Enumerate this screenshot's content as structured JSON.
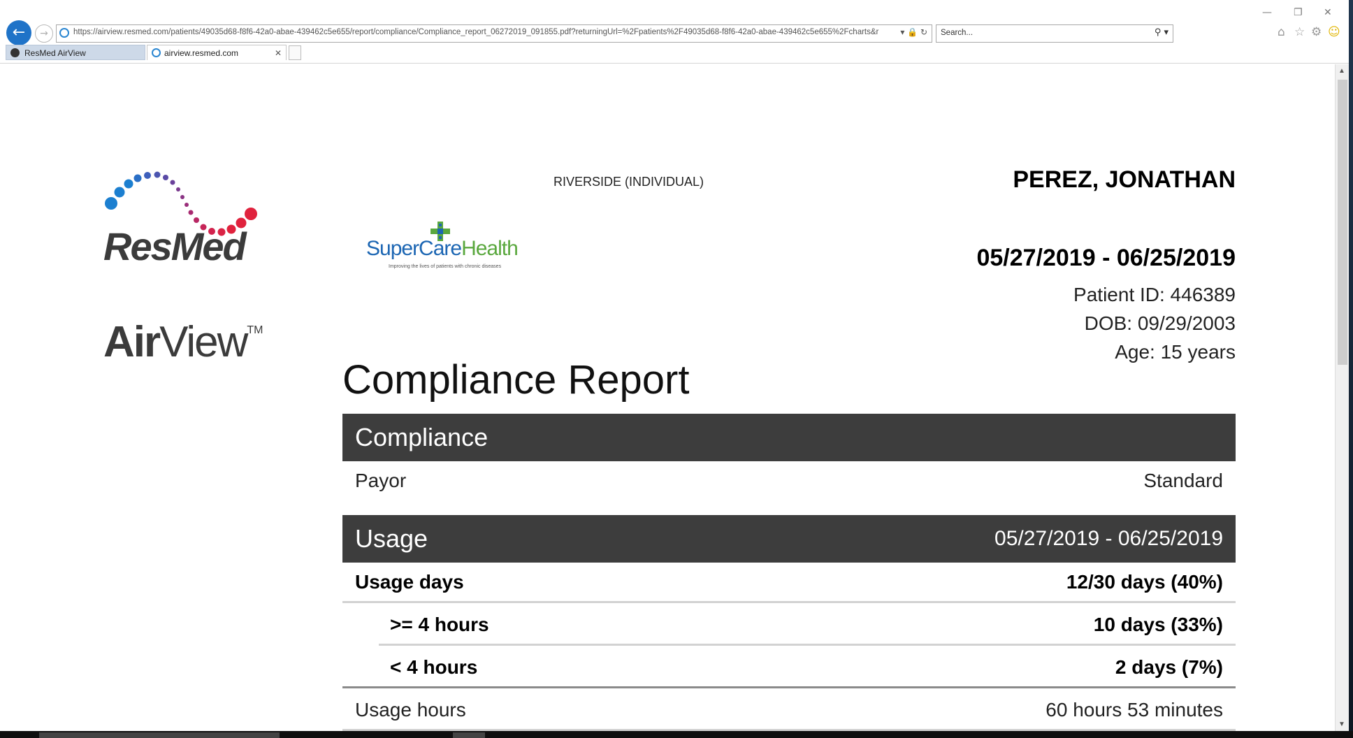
{
  "browser": {
    "url": "https://airview.resmed.com/patients/49035d68-f8f6-42a0-abae-439462c5e655/report/compliance/Compliance_report_06272019_091855.pdf?returningUrl=%2Fpatients%2F49035d68-f8f6-42a0-abae-439462c5e655%2Fcharts&r",
    "search_placeholder": "Search...",
    "tabs": [
      {
        "label": "ResMed AirView"
      },
      {
        "label": "airview.resmed.com"
      }
    ]
  },
  "brand": {
    "resmed": "ResMed",
    "airview_bold": "Air",
    "airview_rest": "View",
    "tm": "TM",
    "partner_a": "SuperCare",
    "partner_b": "Health",
    "partner_tagline": "Improving the lives of patients with chronic diseases"
  },
  "header": {
    "location": "RIVERSIDE (INDIVIDUAL)",
    "patient_name": "PEREZ, JONATHAN",
    "date_range": "05/27/2019 - 06/25/2019",
    "patient_id": "Patient ID: 446389",
    "dob": "DOB: 09/29/2003",
    "age": "Age: 15 years"
  },
  "report": {
    "title": "Compliance Report",
    "compliance": {
      "heading": "Compliance",
      "payor_label": "Payor",
      "payor_value": "Standard"
    },
    "usage": {
      "heading": "Usage",
      "range": "05/27/2019 - 06/25/2019",
      "rows": [
        {
          "label": "Usage days",
          "value": "12/30 days (40%)"
        },
        {
          "label": ">= 4 hours",
          "value": "10 days (33%)"
        },
        {
          "label": "< 4 hours",
          "value": "2 days (7%)"
        },
        {
          "label": "Usage hours",
          "value": "60 hours 53 minutes"
        }
      ]
    }
  },
  "colors": {
    "section_bg": "#3d3d3d",
    "logo_blue": "#1c7fd0",
    "logo_purple": "#7a3a8e",
    "logo_red": "#e0223d"
  }
}
